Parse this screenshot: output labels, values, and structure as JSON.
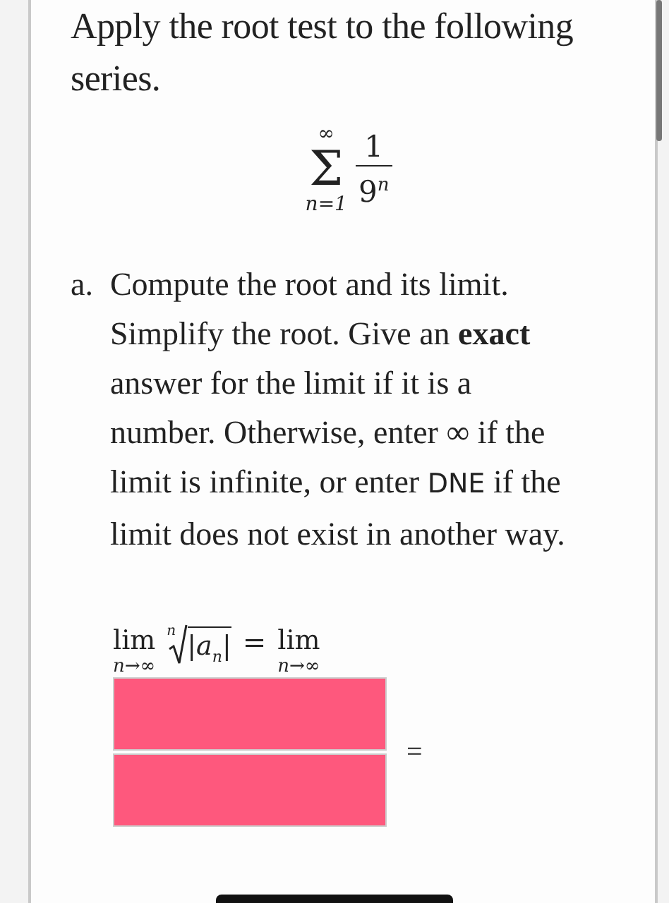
{
  "question": {
    "text": "Apply the root test to the following series.",
    "series": {
      "upper": "∞",
      "operator": "Σ",
      "lower": "n=1",
      "numerator": "1",
      "denominator": "9$^{n}$"
    }
  },
  "part": {
    "label": "a.",
    "segments": [
      {
        "kind": "plain",
        "text": "Compute the root and its limit. Simplify the root. Give an "
      },
      {
        "kind": "bold",
        "text": "exact"
      },
      {
        "kind": "plain",
        "text": " answer for the limit if it is a number. Otherwise, enter ∞ if the limit is infinite, or enter "
      },
      {
        "kind": "code",
        "text": "DNE"
      },
      {
        "kind": "plain",
        "text": " if the limit does not exist in another way."
      }
    ]
  },
  "limit": {
    "lim_left": "lim",
    "sub_left": "n→∞",
    "root_index": "n",
    "radicand": "|a$_{n}$|",
    "equals": "=",
    "lim_right": "lim",
    "sub_right": "n→∞",
    "fraction_fields": [
      {
        "invalid": true
      },
      {
        "invalid": true
      }
    ],
    "result_equals": "="
  }
}
